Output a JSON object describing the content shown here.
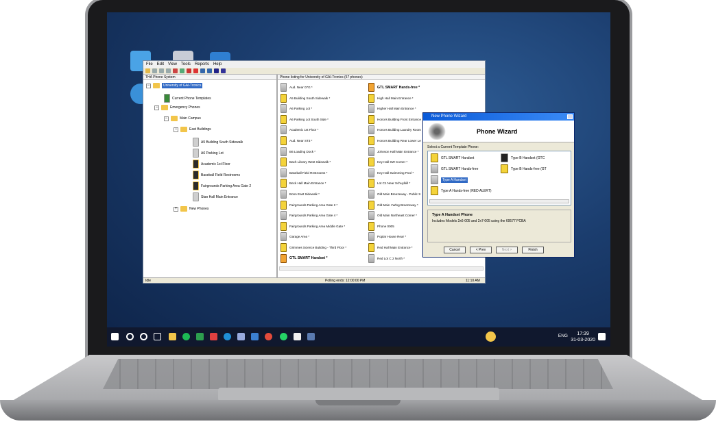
{
  "menu": [
    "File",
    "Edit",
    "View",
    "Tools",
    "Reports",
    "Help"
  ],
  "left_pane": {
    "header": "THA Phone System",
    "tree": {
      "root": "University of GAI-Tronics",
      "templates": "Current Phone Templates",
      "emergency": "Emergency Phones",
      "main_campus": "Main Campus",
      "east_buildings": "East Buildings",
      "leaves": [
        "A5 Building South Sidewalk",
        "A6 Parking Lot",
        "Academic 1st Floor",
        "Baseball Field Restrooms",
        "Fairgrounds Parking Area Gate 2",
        "Stan Hall Main Entrance"
      ],
      "new_phones": "New Phones"
    }
  },
  "right_pane": {
    "header": "Phone listing for University of GAI-Tronics (57 phones)",
    "col1": [
      "Aud. Near 07G *",
      "A5 Building South Sidewalk *",
      "A6 Parking Lot *",
      "A6 Parking Lot South Side *",
      "Academic 1st Floor *",
      "Aud. Near ST3 *",
      "B6 Loading Dock *",
      "Bach Library West Sidewalk *",
      "Baseball Field Restrooms *",
      "Beck Hall Main Entrance *",
      "Bonn East Sidewalk *",
      "Fairgrounds Parking Area Gate 2 *",
      "Fairgrounds Parking Area Gate 4 *",
      "Fairgrounds Parking Area Middle Gate *",
      "Garage Area *",
      "Grimmes Science Building - Third Floor *",
      "GTL SMART Handset *"
    ],
    "col2": [
      "GTL SMART Hands-free *",
      "High Hall Main Entrance *",
      "Higher Hall Main Entrance *",
      "Honors Building Front Entrance",
      "Honors Building Laundry Room",
      "Honors Building Rear Lower Le",
      "Johnson Hall Main Entrance *",
      "Key Hall SW Corner *",
      "Key Hall Swimming Pool *",
      "Lot C1 Near Schuylkill *",
      "Old Main Breezeway - Public S",
      "Old Main I Wing Breezeway *",
      "Old Main Northeast Corner *",
      "Phone 0005",
      "Poplar House Rear *",
      "Red Hall Main Entrance *",
      "Red Lot C 2 North *"
    ]
  },
  "status": {
    "left": "Idle",
    "middle": "Polling ends: 12:00:00 PM",
    "right": "11:10 AM"
  },
  "wizard": {
    "title": "New Phone Wizard",
    "header": "Phone Wizard",
    "prompt": "Select a Current Template Phone:",
    "options": [
      "GTL SMART Handset",
      "GTL SMART Hands-free",
      "Type A Handset",
      "Type A Hands-free (RED ALERT)"
    ],
    "options_right": [
      "Type B Handset (GTC",
      "Type B Hands-free (GT"
    ],
    "desc_title": "Type A Handset Phone",
    "desc_text": "Includes Models 2x6-005 and 2x7-005 using the 69577 PCBA",
    "buttons": [
      "Cancel",
      "< Prev",
      "Next >",
      "Finish"
    ]
  },
  "taskbar": {
    "lang": "ENG",
    "time": "17:39",
    "date": "31-03-2020"
  }
}
